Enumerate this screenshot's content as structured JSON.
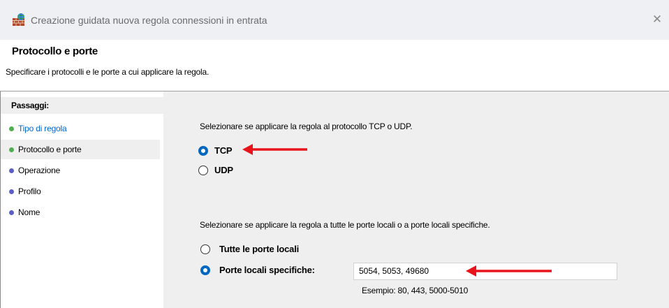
{
  "window": {
    "title": "Creazione guidata nuova regola connessioni in entrata",
    "app_icon": "firewall-icon",
    "close_icon": "close-icon",
    "close_glyph": "✕"
  },
  "header": {
    "title": "Protocollo e porte",
    "subtitle": "Specificare i protocolli e le porte a cui applicare la regola."
  },
  "sidebar": {
    "heading": "Passaggi:",
    "steps": [
      {
        "label": "Tipo di regola",
        "state": "completed",
        "dot_color": "#4caf50"
      },
      {
        "label": "Protocollo e porte",
        "state": "current",
        "dot_color": "#4caf50"
      },
      {
        "label": "Operazione",
        "state": "pending",
        "dot_color": "#5b5fc7"
      },
      {
        "label": "Profilo",
        "state": "pending",
        "dot_color": "#5b5fc7"
      },
      {
        "label": "Nome",
        "state": "pending",
        "dot_color": "#5b5fc7"
      }
    ]
  },
  "main": {
    "protocol_prompt": "Selezionare se applicare la regola al protocollo TCP o UDP.",
    "protocol_options": [
      {
        "label": "TCP",
        "selected": true
      },
      {
        "label": "UDP",
        "selected": false
      }
    ],
    "ports_prompt": "Selezionare se applicare la regola a tutte le porte locali o a porte locali specifiche.",
    "port_options": [
      {
        "label": "Tutte le porte locali",
        "selected": false
      },
      {
        "label": "Porte locali specifiche:",
        "selected": true
      }
    ],
    "ports_value": "5054, 5053, 49680",
    "ports_example": "Esempio: 80, 443, 5000-5010"
  },
  "colors": {
    "accent": "#0067c0",
    "annotation_arrow": "#e8141b",
    "link": "#0066cc"
  }
}
